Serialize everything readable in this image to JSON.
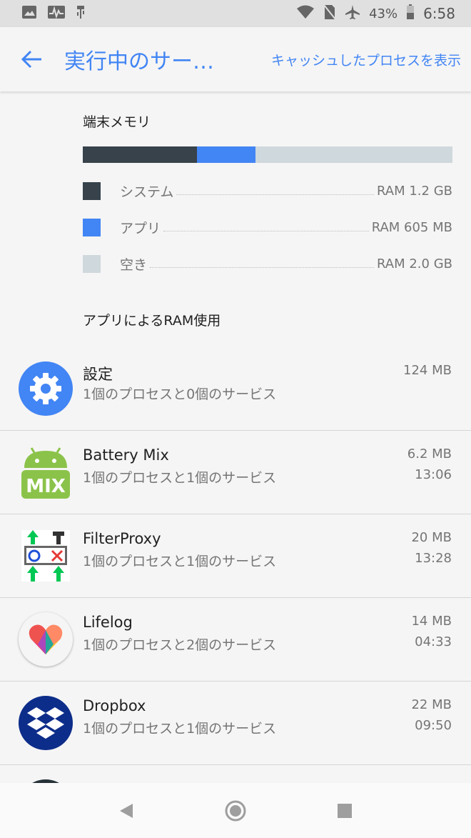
{
  "status_bar": {
    "battery_percent": "43%",
    "time": "6:58"
  },
  "app_bar": {
    "title": "実行中のサー…",
    "cached_action": "キャッシュしたプロセスを表示"
  },
  "memory": {
    "title": "端末メモリ",
    "usage": {
      "system_fraction": 0.309,
      "apps_fraction": 0.158
    },
    "colors": {
      "system": "#37424b",
      "apps": "#4285f4",
      "free": "#cfd8dc"
    },
    "legend": [
      {
        "label": "システム",
        "value": "RAM 1.2 GB"
      },
      {
        "label": "アプリ",
        "value": "RAM 605 MB"
      },
      {
        "label": "空き",
        "value": "RAM 2.0 GB"
      }
    ]
  },
  "apps_section": {
    "title": "アプリによるRAM使用",
    "items": [
      {
        "name": "設定",
        "sub": "1個のプロセスと0個のサービス",
        "mem": "124 MB",
        "time": "",
        "icon": "settings-gear-icon"
      },
      {
        "name": "Battery Mix",
        "sub": "1個のプロセスと1個のサービス",
        "mem": "6.2 MB",
        "time": "13:06",
        "icon": "android-mix-icon",
        "icon_text": "MIX"
      },
      {
        "name": "FilterProxy",
        "sub": "1個のプロセスと1個のサービス",
        "mem": "20 MB",
        "time": "13:28",
        "icon": "filterproxy-icon"
      },
      {
        "name": "Lifelog",
        "sub": "1個のプロセスと2個のサービス",
        "mem": "14 MB",
        "time": "04:33",
        "icon": "lifelog-heart-icon"
      },
      {
        "name": "Dropbox",
        "sub": "1個のプロセスと1個のサービス",
        "mem": "22 MB",
        "time": "09:50",
        "icon": "dropbox-icon"
      }
    ]
  },
  "nav": {
    "back": "back-icon",
    "home": "home-icon",
    "recents": "recents-icon"
  }
}
